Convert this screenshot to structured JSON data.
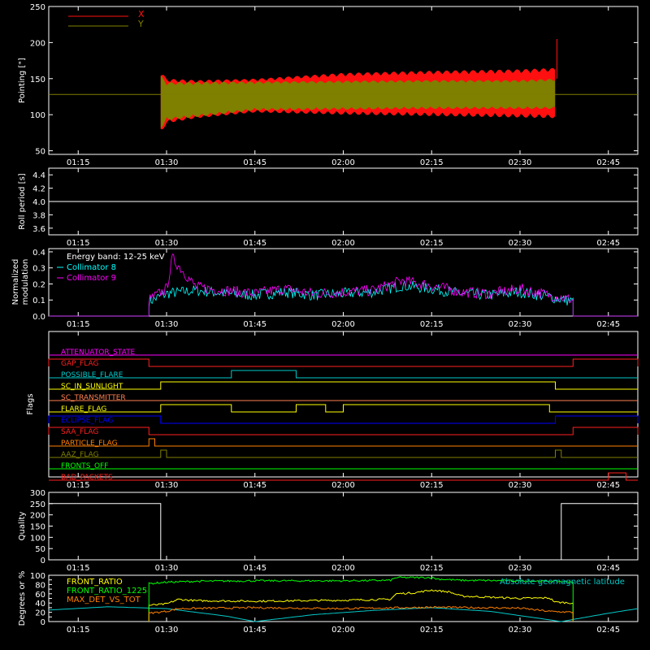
{
  "time_ticks": [
    "01:15",
    "01:30",
    "01:45",
    "02:00",
    "02:15",
    "02:30",
    "02:45"
  ],
  "time_range": [
    "01:10",
    "02:50"
  ],
  "colors": {
    "X": "#ff1010",
    "Y": "#7f7f00",
    "white": "#ffffff",
    "c8": "#00ffff",
    "c9": "#ff00ff",
    "attenuator": "#ff00ff",
    "gap": "#ff2020",
    "possible_flare": "#00c8c8",
    "sunlight": "#ffff00",
    "sc_tx": "#ff7f50",
    "flare_flag": "#ffff00",
    "eclipse": "#0000ff",
    "saa": "#ff2020",
    "particle": "#ff8000",
    "aaz": "#808000",
    "fronts_off": "#00ff00",
    "bad_packets": "#ff2020",
    "front_ratio": "#ffff00",
    "front_ratio_1225": "#00ff00",
    "max_det": "#ff8000",
    "geolat": "#00c8c8"
  },
  "chart_data": [
    {
      "type": "area",
      "name": "pointing",
      "ylabel": "Pointing [\"]",
      "ylim": [
        45,
        250
      ],
      "yticks": [
        "50",
        "100",
        "150",
        "200",
        "250"
      ],
      "legend": [
        "X",
        "Y"
      ],
      "reference_level": 128,
      "active_range": [
        "01:29",
        "02:37"
      ],
      "series": [
        {
          "name": "X",
          "envelope": [
            {
              "t": "01:29",
              "low": 72,
              "high": 162
            },
            {
              "t": "01:30",
              "low": 88,
              "high": 150
            },
            {
              "t": "01:35",
              "low": 95,
              "high": 148
            },
            {
              "t": "01:45",
              "low": 103,
              "high": 150
            },
            {
              "t": "02:00",
              "low": 100,
              "high": 158
            },
            {
              "t": "02:15",
              "low": 98,
              "high": 161
            },
            {
              "t": "02:30",
              "low": 96,
              "high": 163
            },
            {
              "t": "02:36",
              "low": 95,
              "high": 165
            }
          ]
        },
        {
          "name": "Y",
          "envelope": [
            {
              "t": "01:29",
              "low": 80,
              "high": 155
            },
            {
              "t": "01:30",
              "low": 92,
              "high": 145
            },
            {
              "t": "01:45",
              "low": 106,
              "high": 146
            },
            {
              "t": "02:00",
              "low": 107,
              "high": 147
            },
            {
              "t": "02:15",
              "low": 108,
              "high": 148
            },
            {
              "t": "02:30",
              "low": 108,
              "high": 148
            },
            {
              "t": "02:36",
              "low": 108,
              "high": 150
            }
          ]
        }
      ],
      "spikes": [
        {
          "t": "02:36",
          "value": 205
        }
      ]
    },
    {
      "type": "line",
      "name": "roll_period",
      "ylabel": "Roll period [s]",
      "ylim": [
        3.5,
        4.5
      ],
      "yticks": [
        "3.6",
        "3.8",
        "4.0",
        "4.2",
        "4.4"
      ],
      "value": 4.0
    },
    {
      "type": "line",
      "name": "modulation",
      "ylabel": "Normalized modulation",
      "ylim": [
        0,
        0.42
      ],
      "yticks": [
        "0.0",
        "0.1",
        "0.2",
        "0.3",
        "0.4"
      ],
      "annotation": "Energy band: 12-25 keV",
      "active_range": [
        "01:27",
        "02:39"
      ],
      "series": [
        {
          "name": "Collimator 8",
          "points": [
            [
              "01:27",
              0.09
            ],
            [
              "01:30",
              0.14
            ],
            [
              "01:35",
              0.16
            ],
            [
              "01:40",
              0.14
            ],
            [
              "01:45",
              0.13
            ],
            [
              "01:50",
              0.15
            ],
            [
              "01:55",
              0.13
            ],
            [
              "02:00",
              0.14
            ],
            [
              "02:05",
              0.15
            ],
            [
              "02:10",
              0.19
            ],
            [
              "02:15",
              0.17
            ],
            [
              "02:20",
              0.14
            ],
            [
              "02:25",
              0.13
            ],
            [
              "02:30",
              0.15
            ],
            [
              "02:35",
              0.12
            ],
            [
              "02:39",
              0.09
            ]
          ]
        },
        {
          "name": "Collimator 9",
          "points": [
            [
              "01:27",
              0.1
            ],
            [
              "01:30",
              0.17
            ],
            [
              "01:31",
              0.36
            ],
            [
              "01:35",
              0.18
            ],
            [
              "01:40",
              0.16
            ],
            [
              "01:45",
              0.14
            ],
            [
              "01:50",
              0.17
            ],
            [
              "01:55",
              0.14
            ],
            [
              "02:00",
              0.15
            ],
            [
              "02:05",
              0.16
            ],
            [
              "02:10",
              0.22
            ],
            [
              "02:15",
              0.19
            ],
            [
              "02:20",
              0.15
            ],
            [
              "02:25",
              0.14
            ],
            [
              "02:30",
              0.17
            ],
            [
              "02:35",
              0.13
            ],
            [
              "02:39",
              0.1
            ]
          ]
        }
      ]
    },
    {
      "type": "line",
      "name": "flags",
      "ylabel": "Flags",
      "flags": [
        {
          "name": "ATTENUATOR_STATE",
          "color_key": "attenuator",
          "high": []
        },
        {
          "name": "GAP_FLAG",
          "color_key": "gap",
          "high": [
            [
              "01:10",
              "01:27"
            ],
            [
              "02:39",
              "02:50"
            ]
          ]
        },
        {
          "name": "POSSIBLE_FLARE",
          "color_key": "possible_flare",
          "high": [
            [
              "01:41",
              "01:52"
            ]
          ]
        },
        {
          "name": "SC_IN_SUNLIGHT",
          "color_key": "sunlight",
          "high": [
            [
              "01:29",
              "02:36"
            ]
          ]
        },
        {
          "name": "SC_TRANSMITTER",
          "color_key": "sc_tx",
          "high": []
        },
        {
          "name": "FLARE_FLAG",
          "color_key": "flare_flag",
          "high": [
            [
              "01:29",
              "01:41"
            ],
            [
              "01:52",
              "01:57"
            ],
            [
              "02:00",
              "02:35"
            ]
          ]
        },
        {
          "name": "ECLIPSE_FLAG",
          "color_key": "eclipse",
          "high": [
            [
              "01:10",
              "01:29"
            ],
            [
              "02:36",
              "02:50"
            ]
          ]
        },
        {
          "name": "SAA_FLAG",
          "color_key": "saa",
          "high": [
            [
              "01:10",
              "01:27"
            ],
            [
              "02:39",
              "02:50"
            ]
          ]
        },
        {
          "name": "PARTICLE_FLAG",
          "color_key": "particle",
          "high": [
            [
              "01:27",
              "01:28"
            ]
          ]
        },
        {
          "name": "AAZ_FLAG",
          "color_key": "aaz",
          "high": [
            [
              "01:29",
              "01:30"
            ],
            [
              "02:36",
              "02:37"
            ]
          ]
        },
        {
          "name": "FRONTS_OFF",
          "color_key": "fronts_off",
          "high": []
        },
        {
          "name": "BAD_PACKETS",
          "color_key": "bad_packets",
          "high": [
            [
              "02:45",
              "02:48"
            ]
          ]
        }
      ]
    },
    {
      "type": "line",
      "name": "quality",
      "ylabel": "Quality",
      "ylim": [
        0,
        300
      ],
      "yticks": [
        "0",
        "50",
        "100",
        "150",
        "200",
        "250",
        "300"
      ],
      "points": [
        [
          "01:10",
          250
        ],
        [
          "01:29",
          250
        ],
        [
          "01:29",
          0
        ],
        [
          "02:37",
          0
        ],
        [
          "02:37",
          250
        ],
        [
          "02:50",
          250
        ]
      ]
    },
    {
      "type": "line",
      "name": "ratios",
      "ylabel": "Degrees or %",
      "ylim": [
        0,
        100
      ],
      "yticks": [
        "0",
        "10",
        "20",
        "30",
        "40",
        "50",
        "60",
        "70",
        "80",
        "90",
        "100"
      ],
      "annotation": "Absolute geomagnetic latitude",
      "series": [
        {
          "name": "FRONT_RATIO",
          "color_key": "front_ratio",
          "points": [
            [
              "01:27",
              35
            ],
            [
              "01:30",
              38
            ],
            [
              "01:32",
              48
            ],
            [
              "01:35",
              45
            ],
            [
              "01:45",
              44
            ],
            [
              "02:00",
              46
            ],
            [
              "02:08",
              48
            ],
            [
              "02:09",
              60
            ],
            [
              "02:12",
              62
            ],
            [
              "02:15",
              68
            ],
            [
              "02:18",
              64
            ],
            [
              "02:20",
              55
            ],
            [
              "02:30",
              50
            ],
            [
              "02:35",
              51
            ],
            [
              "02:36",
              42
            ],
            [
              "02:39",
              40
            ]
          ]
        },
        {
          "name": "FRONT_RATIO_1225",
          "color_key": "front_ratio_1225",
          "points": [
            [
              "01:27",
              82
            ],
            [
              "01:30",
              85
            ],
            [
              "01:35",
              87
            ],
            [
              "01:45",
              88
            ],
            [
              "02:00",
              88
            ],
            [
              "02:08",
              89
            ],
            [
              "02:09",
              95
            ],
            [
              "02:15",
              95
            ],
            [
              "02:16",
              92
            ],
            [
              "02:20",
              89
            ],
            [
              "02:30",
              88
            ],
            [
              "02:39",
              86
            ]
          ]
        },
        {
          "name": "MAX_DET_VS_TOT",
          "color_key": "max_det",
          "points": [
            [
              "01:27",
              18
            ],
            [
              "01:30",
              22
            ],
            [
              "01:32",
              28
            ],
            [
              "01:45",
              30
            ],
            [
              "02:00",
              28
            ],
            [
              "02:15",
              31
            ],
            [
              "02:30",
              29
            ],
            [
              "02:35",
              22
            ],
            [
              "02:39",
              20
            ]
          ]
        }
      ],
      "geolat": [
        [
          "01:10",
          25
        ],
        [
          "01:20",
          32
        ],
        [
          "01:30",
          28
        ],
        [
          "01:40",
          12
        ],
        [
          "01:45",
          0
        ],
        [
          "01:55",
          15
        ],
        [
          "02:05",
          24
        ],
        [
          "02:15",
          30
        ],
        [
          "02:25",
          22
        ],
        [
          "02:37",
          0
        ],
        [
          "02:45",
          18
        ],
        [
          "02:50",
          28
        ]
      ]
    }
  ]
}
